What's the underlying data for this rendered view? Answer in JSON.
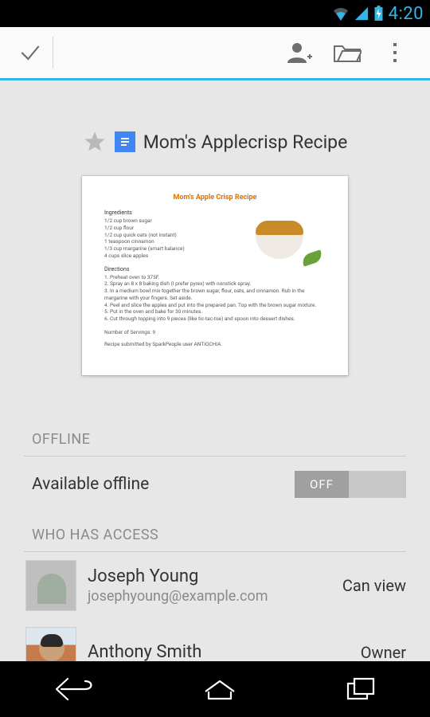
{
  "status": {
    "time": "4:20"
  },
  "doc": {
    "title": "Mom's Applecrisp Recipe",
    "preview": {
      "title": "Mom's Apple Crisp Recipe",
      "sec1": "Ingredients",
      "ing": [
        "1/2 cup brown sugar",
        "1/2 cup flour",
        "1/2 cup quick oats (not instant)",
        "1 teaspoon cinnamon",
        "1/3 cup margarine (smart balance)",
        "4 cups slice apples"
      ],
      "sec2": "Directions",
      "dir": [
        "1. Preheat oven to 375F.",
        "2. Spray an 8 x 8 baking dish (I prefer pyrex) with nonstick spray.",
        "3. In a medium bowl mix together the brown sugar, flour, oats, and cinnamon. Rub in the margarine with your fingers. Set aside.",
        "4. Peel and slice the apples and put into the prepared pan. Top with the brown sugar mixture.",
        "5. Put in the oven and bake for 30 minutes.",
        "6. Cut through topping into 9 pieces (like tic-tac-toe) and spoon into dessert dishes."
      ],
      "servings": "Number of Servings: 9",
      "credit": "Recipe submitted by SparkPeople user ANTIOCHIA."
    }
  },
  "sections": {
    "offline_header": "OFFLINE",
    "offline_label": "Available offline",
    "offline_toggle": "OFF",
    "access_header": "WHO HAS ACCESS"
  },
  "people": [
    {
      "name": "Joseph Young",
      "email": "josephyoung@example.com",
      "role": "Can view"
    },
    {
      "name": "Anthony Smith",
      "email": "",
      "role": "Owner"
    }
  ]
}
